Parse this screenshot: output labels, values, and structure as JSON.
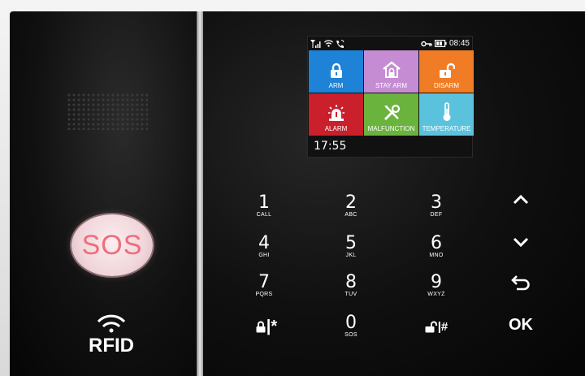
{
  "device": {
    "sos_label": "SOS",
    "rfid_label": "RFID"
  },
  "screen": {
    "status": {
      "clock": "08:45"
    },
    "tiles": [
      {
        "label": "ARM",
        "color": "#1e82d6",
        "icon": "lock-icon"
      },
      {
        "label": "STAY ARM",
        "color": "#c58cd3",
        "icon": "home-lock-icon"
      },
      {
        "label": "DISARM",
        "color": "#f07c25",
        "icon": "unlock-icon"
      },
      {
        "label": "ALARM",
        "color": "#c9202c",
        "icon": "alarm-siren-icon"
      },
      {
        "label": "MALFUNCTION",
        "color": "#6ab43e",
        "icon": "tools-icon"
      },
      {
        "label": "TEMPERATURE",
        "color": "#5bc2de",
        "icon": "thermometer-icon"
      }
    ],
    "time": "17:55"
  },
  "keypad": {
    "k1": {
      "digit": "1",
      "letters": "CALL"
    },
    "k2": {
      "digit": "2",
      "letters": "ABC"
    },
    "k3": {
      "digit": "3",
      "letters": "DEF"
    },
    "k4": {
      "digit": "4",
      "letters": "GHI"
    },
    "k5": {
      "digit": "5",
      "letters": "JKL"
    },
    "k6": {
      "digit": "6",
      "letters": "MNO"
    },
    "k7": {
      "digit": "7",
      "letters": "PQRS"
    },
    "k8": {
      "digit": "8",
      "letters": "TUV"
    },
    "k9": {
      "digit": "9",
      "letters": "WXYZ"
    },
    "k0": {
      "digit": "0",
      "letters": "SOS"
    },
    "arm_key": "|*",
    "disarm_key": "|#",
    "ok": "OK"
  }
}
